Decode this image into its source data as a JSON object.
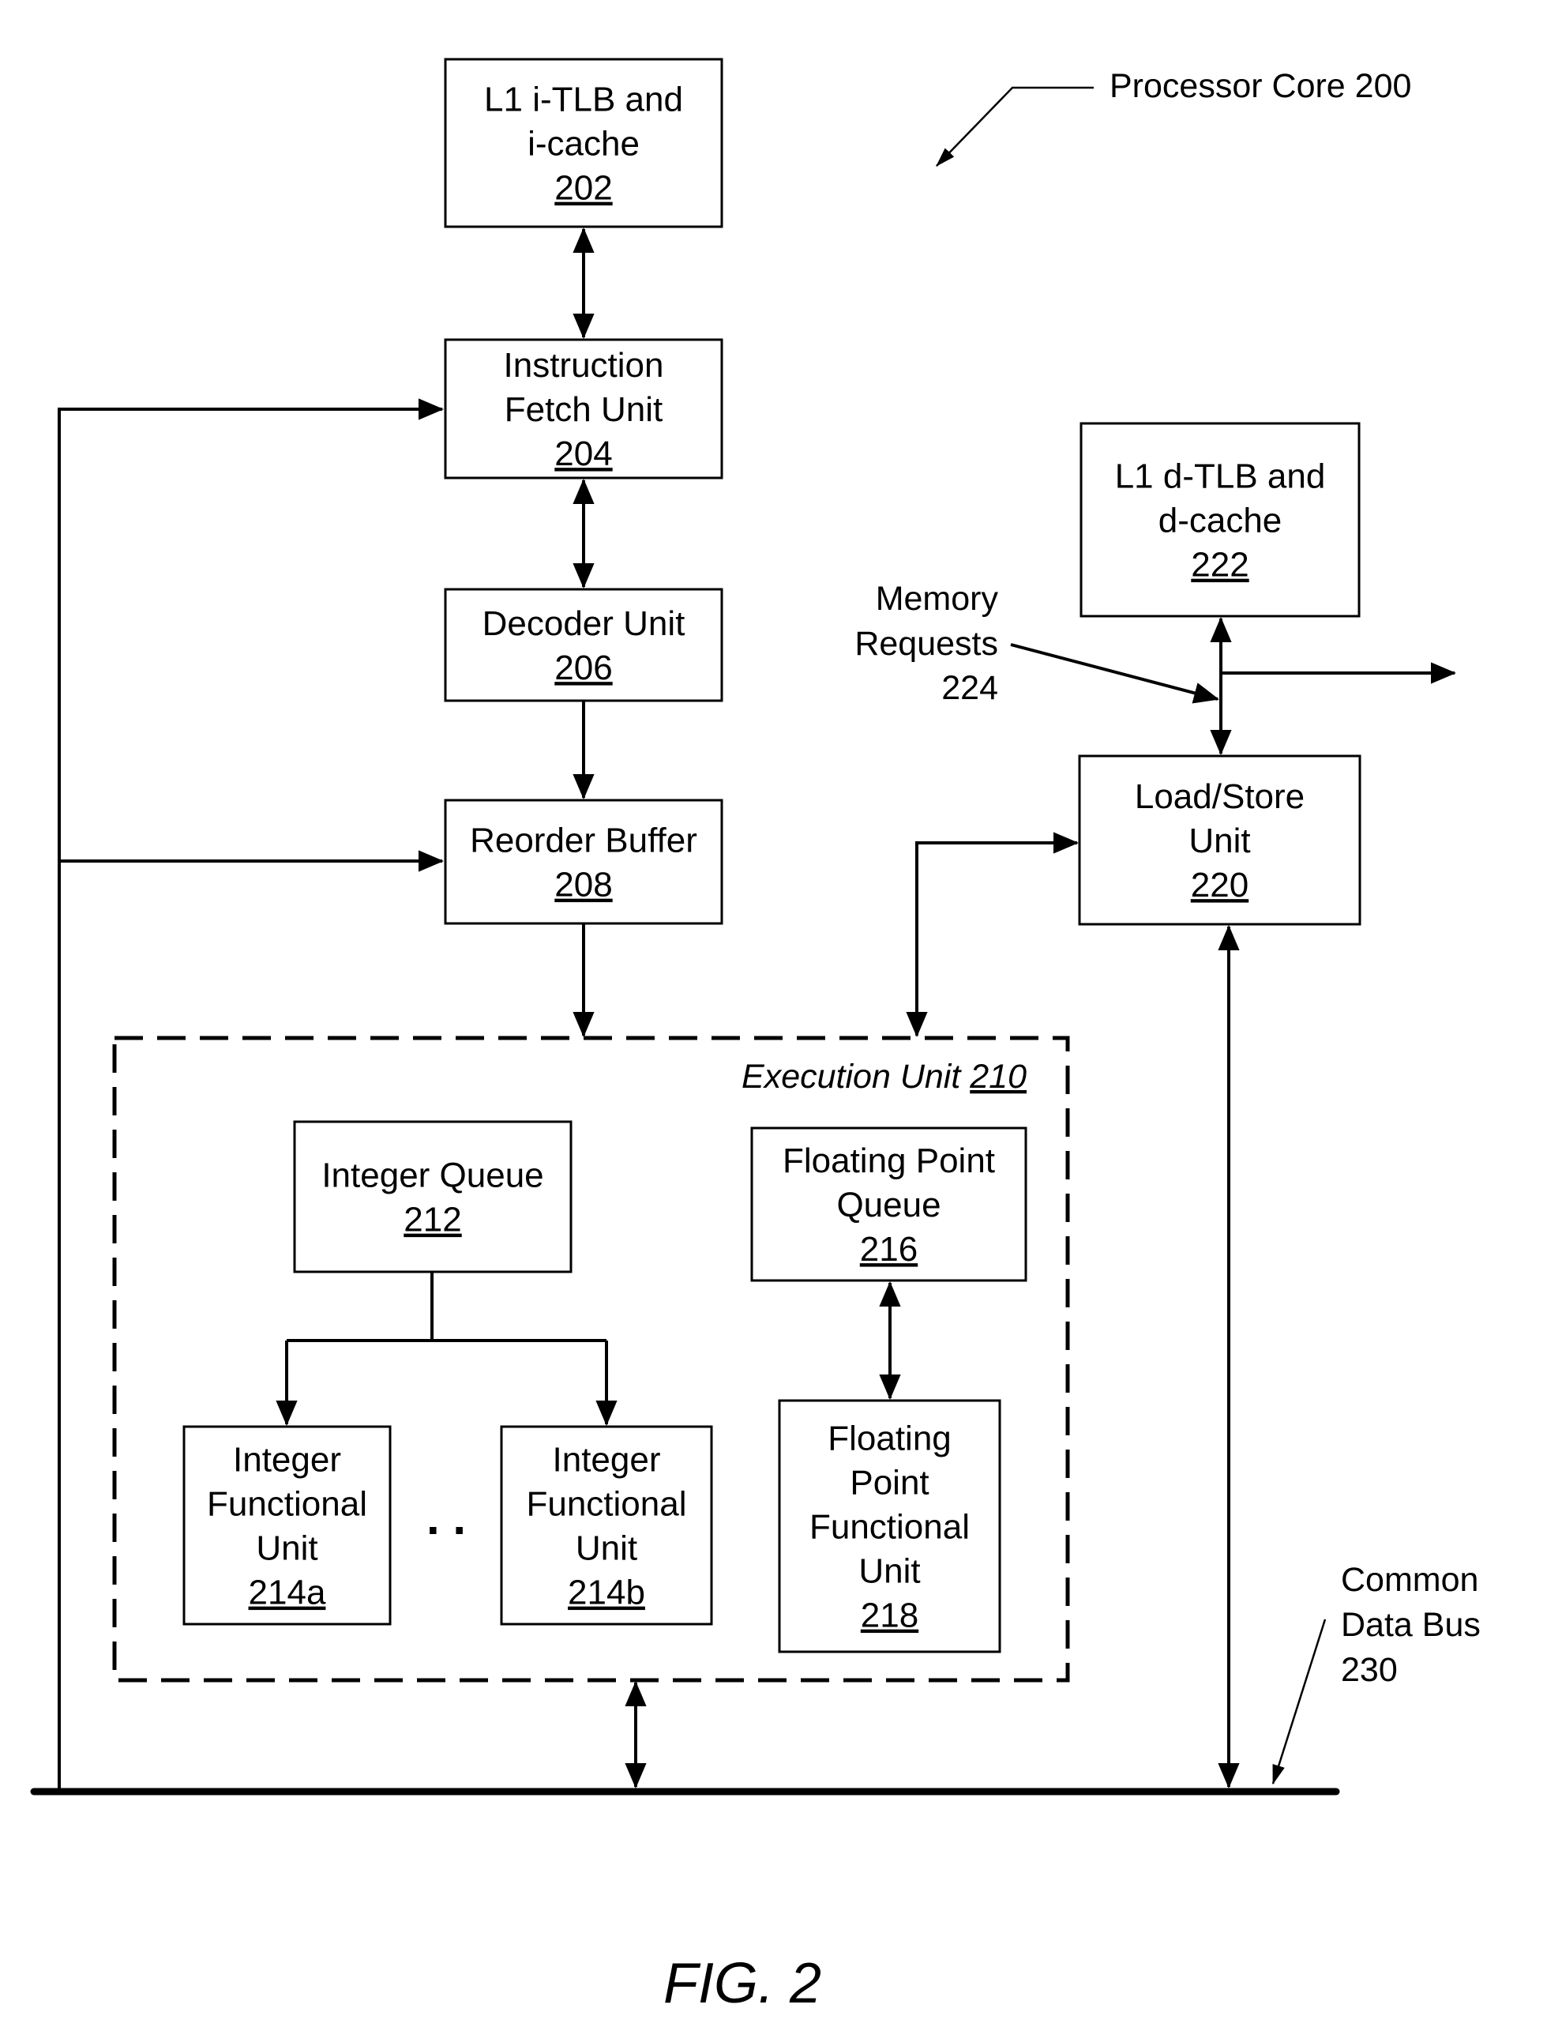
{
  "figure": {
    "title": "Processor Core 200",
    "caption": "FIG. 2"
  },
  "blocks": [
    {
      "id": "l1-icache",
      "lines": [
        "L1 i-TLB and",
        "i-cache"
      ],
      "ref": "202"
    },
    {
      "id": "instruction-fetch-unit",
      "lines": [
        "Instruction",
        "Fetch Unit"
      ],
      "ref": "204"
    },
    {
      "id": "decoder-unit",
      "lines": [
        "Decoder Unit"
      ],
      "ref": "206"
    },
    {
      "id": "reorder-buffer",
      "lines": [
        "Reorder Buffer"
      ],
      "ref": "208"
    },
    {
      "id": "integer-queue",
      "lines": [
        "Integer Queue"
      ],
      "ref": "212"
    },
    {
      "id": "floating-point-queue",
      "lines": [
        "Floating Point",
        "Queue"
      ],
      "ref": "216"
    },
    {
      "id": "integer-functional-unit-a",
      "lines": [
        "Integer",
        "Functional",
        "Unit"
      ],
      "ref": "214a"
    },
    {
      "id": "integer-functional-unit-b",
      "lines": [
        "Integer",
        "Functional",
        "Unit"
      ],
      "ref": "214b"
    },
    {
      "id": "floating-point-functional-unit",
      "lines": [
        "Floating",
        "Point",
        "Functional",
        "Unit"
      ],
      "ref": "218"
    },
    {
      "id": "l1-dcache",
      "lines": [
        "L1 d-TLB and",
        "d-cache"
      ],
      "ref": "222"
    },
    {
      "id": "load-store-unit",
      "lines": [
        "Load/Store",
        "Unit"
      ],
      "ref": "220"
    }
  ],
  "execution_unit": {
    "label": "Execution Unit",
    "ref": "210"
  },
  "ellipsis": ". .",
  "annotations": {
    "memory_requests": {
      "lines": [
        "Memory",
        "Requests",
        "224"
      ]
    },
    "common_data_bus": {
      "lines": [
        "Common",
        "Data Bus",
        "230"
      ]
    }
  }
}
